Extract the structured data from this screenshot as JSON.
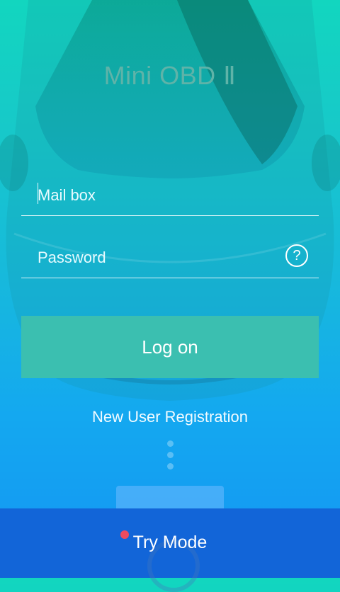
{
  "app": {
    "title": "Mini OBD Ⅱ"
  },
  "login": {
    "mailbox_placeholder": "Mail box",
    "password_placeholder": "Password",
    "help_glyph": "?",
    "logon_label": "Log on"
  },
  "links": {
    "register_label": "New User Registration"
  },
  "footer": {
    "try_mode_label": "Try Mode"
  },
  "colors": {
    "logon_button": "#3bbfb0",
    "try_mode_bar": "#1265d8",
    "notification_badge": "#ee4b5f"
  }
}
